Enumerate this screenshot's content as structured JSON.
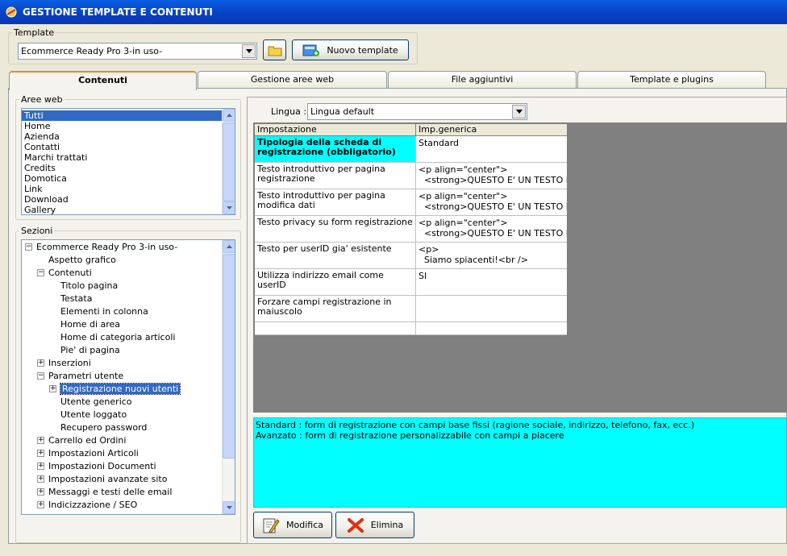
{
  "window": {
    "title": "GESTIONE TEMPLATE E CONTENUTI"
  },
  "template_group": {
    "legend": "Template",
    "selected": "Ecommerce Ready Pro 3-in uso-",
    "new_button": "Nuovo template"
  },
  "tabs": [
    "Contenuti",
    "Gestione aree web",
    "File aggiuntivi",
    "Template e plugins"
  ],
  "aree_web": {
    "legend": "Aree web",
    "items": [
      "Tutti",
      "Home",
      "Azienda",
      "Contatti",
      "Marchi trattati",
      "Credits",
      "Domotica",
      "Link",
      "Download",
      "Gallery"
    ],
    "selected_index": 0
  },
  "sezioni": {
    "legend": "Sezioni",
    "nodes": [
      {
        "label": "Ecommerce Ready Pro 3-in uso-",
        "level": 0,
        "expander": "-"
      },
      {
        "label": "Aspetto grafico",
        "level": 1,
        "expander": ""
      },
      {
        "label": "Contenuti",
        "level": 1,
        "expander": "-"
      },
      {
        "label": "Titolo pagina",
        "level": 2,
        "expander": ""
      },
      {
        "label": "Testata",
        "level": 2,
        "expander": ""
      },
      {
        "label": "Elementi in colonna",
        "level": 2,
        "expander": ""
      },
      {
        "label": "Home di area",
        "level": 2,
        "expander": ""
      },
      {
        "label": "Home di categoria articoli",
        "level": 2,
        "expander": ""
      },
      {
        "label": "Pie' di pagina",
        "level": 2,
        "expander": ""
      },
      {
        "label": "Inserzioni",
        "level": 1,
        "expander": "+"
      },
      {
        "label": "Parametri utente",
        "level": 1,
        "expander": "-"
      },
      {
        "label": "Registrazione nuovi utenti",
        "level": 2,
        "expander": "+",
        "selected": true
      },
      {
        "label": "Utente generico",
        "level": 2,
        "expander": ""
      },
      {
        "label": "Utente loggato",
        "level": 2,
        "expander": ""
      },
      {
        "label": "Recupero password",
        "level": 2,
        "expander": ""
      },
      {
        "label": "Carrello ed Ordini",
        "level": 1,
        "expander": "+"
      },
      {
        "label": "Impostazioni Articoli",
        "level": 1,
        "expander": "+"
      },
      {
        "label": "Impostazioni Documenti",
        "level": 1,
        "expander": "+"
      },
      {
        "label": "Impostazioni avanzate sito",
        "level": 1,
        "expander": "+"
      },
      {
        "label": "Messaggi e testi delle email",
        "level": 1,
        "expander": "+"
      },
      {
        "label": "Indicizzazione / SEO",
        "level": 1,
        "expander": "+"
      }
    ]
  },
  "lingua": {
    "label": "Lingua :",
    "selected": "Lingua default"
  },
  "grid": {
    "headers": [
      "Impostazione",
      "Imp.generica"
    ],
    "rows": [
      {
        "setting": "Tipologia della scheda di registrazione (obbligatorio)",
        "value": "Standard",
        "highlight": true
      },
      {
        "setting": "Testo introduttivo per pagina registrazione",
        "value": "<p align=\"center\">\n  <strong>QUESTO E' UN TESTO DI"
      },
      {
        "setting": "Testo introduttivo per pagina modifica dati",
        "value": "<p align=\"center\">\n  <strong>QUESTO E' UN TESTO DI"
      },
      {
        "setting": "Testo privacy su form registrazione",
        "value": "<p align=\"center\">\n  <strong>QUESTO E' UN TESTO DI"
      },
      {
        "setting": "Testo per userID gia' esistente",
        "value": "<p>\n  Siamo spiacenti!<br />"
      },
      {
        "setting": "Utilizza indirizzo email come userID",
        "value": "SI"
      },
      {
        "setting": "Forzare campi registrazione in maiuscolo",
        "value": ""
      },
      {
        "setting": "",
        "value": ""
      }
    ]
  },
  "description": [
    "Standard : form di registrazione con campi base fissi (ragione sociale, indirizzo, telefono, fax, ecc.)",
    "Avanzato : form di registrazione personalizzabile con campi a piacere"
  ],
  "actions": {
    "edit": "Modifica",
    "delete": "Elimina"
  },
  "colors": {
    "titlebar": "#0a5fe3",
    "selection": "#316ac5",
    "highlight": "#00ffff",
    "grid_bg": "#808080"
  }
}
